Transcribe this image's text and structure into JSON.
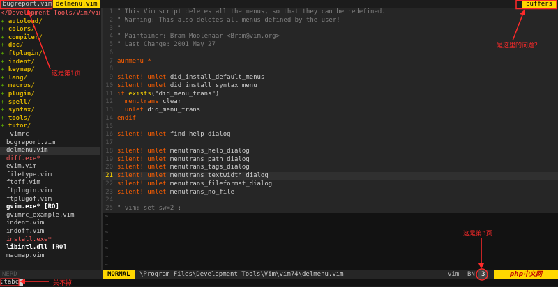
{
  "tabs": {
    "inactive_label": "bugreport.vim",
    "active_label": "delmenu.vim",
    "right_label": "buffers"
  },
  "tree": {
    "root": "</Development Tools/Vim/vim74/",
    "dirs": [
      "autoload/",
      "colors/",
      "compiler/",
      "doc/",
      "ftplugin/",
      "indent/",
      "keymap/",
      "lang/",
      "macros/",
      "plugin/",
      "spell/",
      "syntax/",
      "tools/",
      "tutor/"
    ],
    "files": [
      {
        "name": "_vimrc",
        "style": "normal"
      },
      {
        "name": "bugreport.vim",
        "style": "normal"
      },
      {
        "name": "delmenu.vim",
        "style": "current"
      },
      {
        "name": "diff.exe*",
        "style": "red"
      },
      {
        "name": "evim.vim",
        "style": "normal"
      },
      {
        "name": "filetype.vim",
        "style": "normal"
      },
      {
        "name": "ftoff.vim",
        "style": "normal"
      },
      {
        "name": "ftplugin.vim",
        "style": "normal"
      },
      {
        "name": "ftplugof.vim",
        "style": "normal"
      },
      {
        "name": "gvim.exe* [RO]",
        "style": "boldro"
      },
      {
        "name": "gvimrc_example.vim",
        "style": "normal"
      },
      {
        "name": "indent.vim",
        "style": "normal"
      },
      {
        "name": "indoff.vim",
        "style": "normal"
      },
      {
        "name": "install.exe*",
        "style": "red"
      },
      {
        "name": "libintl.dll [RO]",
        "style": "boldro"
      },
      {
        "name": "macmap.vim",
        "style": "normal"
      }
    ],
    "footer": "NERD"
  },
  "code": [
    {
      "n": "1",
      "t": "\" This Vim script deletes all the menus, so that they can be redefined.",
      "k": "comment"
    },
    {
      "n": "2",
      "t": "\" Warning: This also deletes all menus defined by the user!",
      "k": "comment"
    },
    {
      "n": "3",
      "t": "\"",
      "k": "comment"
    },
    {
      "n": "4",
      "t": "\" Maintainer:   Bram Moolenaar <Bram@vim.org>",
      "k": "comment"
    },
    {
      "n": "5",
      "t": "\" Last Change:  2001 May 27",
      "k": "comment"
    },
    {
      "n": "6",
      "t": "",
      "k": "plain"
    },
    {
      "n": "7",
      "t": "aunmenu *",
      "k": "kwline"
    },
    {
      "n": "8",
      "t": "",
      "k": "plain"
    },
    {
      "n": "9",
      "t": "silent! unlet did_install_default_menus",
      "k": "silent"
    },
    {
      "n": "10",
      "t": "silent! unlet did_install_syntax_menu",
      "k": "silent"
    },
    {
      "n": "11",
      "t": "if exists(\"did_menu_trans\")",
      "k": "if"
    },
    {
      "n": "12",
      "t": "  menutrans clear",
      "k": "menutrans"
    },
    {
      "n": "13",
      "t": "  unlet did_menu_trans",
      "k": "unlet"
    },
    {
      "n": "14",
      "t": "endif",
      "k": "kwline"
    },
    {
      "n": "15",
      "t": "",
      "k": "plain"
    },
    {
      "n": "16",
      "t": "silent! unlet find_help_dialog",
      "k": "silent"
    },
    {
      "n": "17",
      "t": "",
      "k": "plain"
    },
    {
      "n": "18",
      "t": "silent! unlet menutrans_help_dialog",
      "k": "silent"
    },
    {
      "n": "19",
      "t": "silent! unlet menutrans_path_dialog",
      "k": "silent"
    },
    {
      "n": "20",
      "t": "silent! unlet menutrans_tags_dialog",
      "k": "silent"
    },
    {
      "n": "21",
      "t": "silent! unlet menutrans_textwidth_dialog",
      "k": "silent",
      "current": true
    },
    {
      "n": "22",
      "t": "silent! unlet menutrans_fileformat_dialog",
      "k": "silent"
    },
    {
      "n": "23",
      "t": "silent! unlet menutrans_no_file",
      "k": "silent"
    },
    {
      "n": "24",
      "t": "",
      "k": "plain"
    },
    {
      "n": "25",
      "t": "\" vim: set sw=2 :",
      "k": "comment"
    }
  ],
  "tildes": 7,
  "statusbar": {
    "mode": "NORMAL",
    "path": "\\Program Files\\Development Tools\\Vim\\vim74\\delmenu.vim",
    "filetype": "vim",
    "bn_label": "BN",
    "bn_value": "3",
    "watermark": "php中文网"
  },
  "cmdline": {
    "text": ":tabc"
  },
  "annotations": {
    "page1": "这是第1页",
    "question": "是这里的问题？",
    "page3": "这是第3页",
    "cannot_close": "关不掉"
  },
  "colors": {
    "accent_yellow": "#ffd700",
    "annotation_red": "#ff2a2a"
  }
}
